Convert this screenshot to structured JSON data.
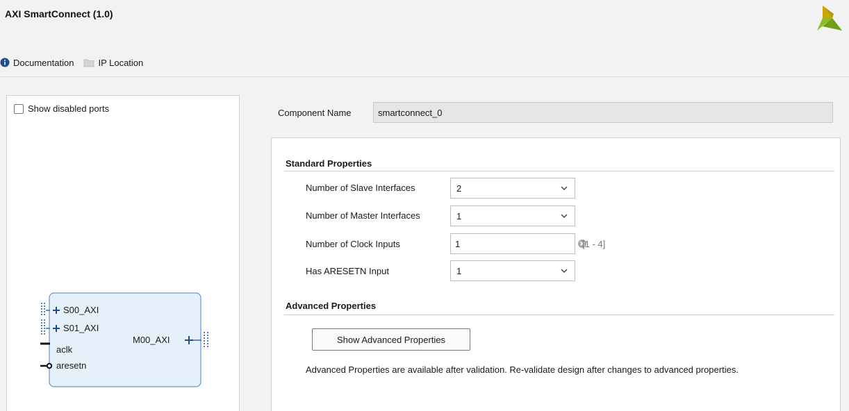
{
  "header": {
    "title": "AXI SmartConnect (1.0)",
    "logo_icon": "xilinx-logo-icon",
    "accent": "#8dbd1f"
  },
  "toolbar": {
    "documentation_label": "Documentation",
    "documentation_icon": "info-icon",
    "ip_location_label": "IP Location",
    "ip_location_icon": "folder-icon"
  },
  "left_panel": {
    "show_disabled_ports_label": "Show disabled ports",
    "show_disabled_ports_checked": false,
    "block": {
      "inputs": [
        {
          "name": "S00_AXI",
          "kind": "bus"
        },
        {
          "name": "S01_AXI",
          "kind": "bus"
        },
        {
          "name": "aclk",
          "kind": "clock"
        },
        {
          "name": "aresetn",
          "kind": "reset"
        }
      ],
      "outputs": [
        {
          "name": "M00_AXI",
          "kind": "bus"
        }
      ]
    }
  },
  "component": {
    "label": "Component Name",
    "value": "smartconnect_0"
  },
  "standard_properties": {
    "title": "Standard Properties",
    "fields": {
      "slave_interfaces": {
        "label": "Number of Slave Interfaces",
        "value": "2"
      },
      "master_interfaces": {
        "label": "Number of Master Interfaces",
        "value": "1"
      },
      "clock_inputs": {
        "label": "Number of Clock Inputs",
        "value": "1",
        "range": "[1 - 4]"
      },
      "has_aresetn": {
        "label": "Has ARESETN Input",
        "value": "1"
      }
    }
  },
  "advanced_properties": {
    "title": "Advanced Properties",
    "button_label": "Show Advanced Properties",
    "note": "Advanced Properties are available after validation. Re-validate design after changes to advanced properties."
  }
}
